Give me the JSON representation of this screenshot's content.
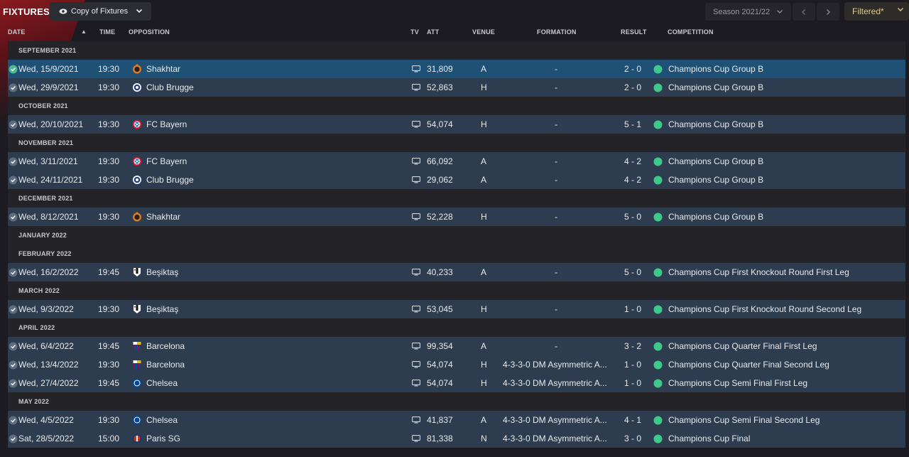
{
  "title": "FIXTURES",
  "view_select": {
    "label": "Copy of Fixtures",
    "icon": "eye-icon"
  },
  "season": {
    "label": "Season 2021/22"
  },
  "filter_button": {
    "label": "Filtered*"
  },
  "columns": {
    "date": "DATE",
    "time": "TIME",
    "opposition": "OPPOSITION",
    "tv": "TV",
    "att": "ATT",
    "venue": "VENUE",
    "formation": "FORMATION",
    "result": "RESULT",
    "competition": "COMPETITION"
  },
  "colors": {
    "win": "#3ec98a",
    "selected_row": "#1f5075",
    "row": "#2d3d4f",
    "accent_filter": "#e4c98c"
  },
  "months": [
    {
      "label": "SEPTEMBER 2021",
      "fixtures": [
        {
          "date": "Wed, 15/9/2021",
          "time": "19:30",
          "opponent": "Shakhtar",
          "crest": "shakhtar",
          "att": "31,809",
          "venue": "A",
          "formation": "-",
          "result": "2 - 0",
          "competition": "Champions Cup Group B",
          "selected": true
        },
        {
          "date": "Wed, 29/9/2021",
          "time": "19:30",
          "opponent": "Club Brugge",
          "crest": "brugge",
          "att": "52,863",
          "venue": "H",
          "formation": "-",
          "result": "2 - 0",
          "competition": "Champions Cup Group B"
        }
      ]
    },
    {
      "label": "OCTOBER 2021",
      "fixtures": [
        {
          "date": "Wed, 20/10/2021",
          "time": "19:30",
          "opponent": "FC Bayern",
          "crest": "bayern",
          "att": "54,074",
          "venue": "H",
          "formation": "-",
          "result": "5 - 1",
          "competition": "Champions Cup Group B"
        }
      ]
    },
    {
      "label": "NOVEMBER 2021",
      "fixtures": [
        {
          "date": "Wed, 3/11/2021",
          "time": "19:30",
          "opponent": "FC Bayern",
          "crest": "bayern",
          "att": "66,092",
          "venue": "A",
          "formation": "-",
          "result": "4 - 2",
          "competition": "Champions Cup Group B"
        },
        {
          "date": "Wed, 24/11/2021",
          "time": "19:30",
          "opponent": "Club Brugge",
          "crest": "brugge",
          "att": "29,062",
          "venue": "A",
          "formation": "-",
          "result": "4 - 2",
          "competition": "Champions Cup Group B"
        }
      ]
    },
    {
      "label": "DECEMBER 2021",
      "fixtures": [
        {
          "date": "Wed, 8/12/2021",
          "time": "19:30",
          "opponent": "Shakhtar",
          "crest": "shakhtar",
          "att": "52,228",
          "venue": "H",
          "formation": "-",
          "result": "5 - 0",
          "competition": "Champions Cup Group B"
        }
      ]
    },
    {
      "label": "JANUARY 2022",
      "fixtures": []
    },
    {
      "label": "FEBRUARY 2022",
      "fixtures": [
        {
          "date": "Wed, 16/2/2022",
          "time": "19:45",
          "opponent": "Beşiktaş",
          "crest": "besiktas",
          "att": "40,233",
          "venue": "A",
          "formation": "-",
          "result": "5 - 0",
          "competition": "Champions Cup First Knockout Round First Leg"
        }
      ]
    },
    {
      "label": "MARCH 2022",
      "fixtures": [
        {
          "date": "Wed, 9/3/2022",
          "time": "19:30",
          "opponent": "Beşiktaş",
          "crest": "besiktas",
          "att": "53,045",
          "venue": "H",
          "formation": "-",
          "result": "1 - 0",
          "competition": "Champions Cup First Knockout Round Second Leg"
        }
      ]
    },
    {
      "label": "APRIL 2022",
      "fixtures": [
        {
          "date": "Wed, 6/4/2022",
          "time": "19:45",
          "opponent": "Barcelona",
          "crest": "barcelona",
          "att": "99,354",
          "venue": "A",
          "formation": "-",
          "result": "3 - 2",
          "competition": "Champions Cup Quarter Final First Leg"
        },
        {
          "date": "Wed, 13/4/2022",
          "time": "19:30",
          "opponent": "Barcelona",
          "crest": "barcelona",
          "att": "54,074",
          "venue": "H",
          "formation": "4-3-3-0 DM Asymmetric A...",
          "result": "1 - 0",
          "competition": "Champions Cup Quarter Final Second Leg"
        },
        {
          "date": "Wed, 27/4/2022",
          "time": "19:45",
          "opponent": "Chelsea",
          "crest": "chelsea",
          "att": "54,074",
          "venue": "H",
          "formation": "4-3-3-0 DM Asymmetric A...",
          "result": "1 - 0",
          "competition": "Champions Cup Semi Final First Leg"
        }
      ]
    },
    {
      "label": "MAY 2022",
      "fixtures": [
        {
          "date": "Wed, 4/5/2022",
          "time": "19:30",
          "opponent": "Chelsea",
          "crest": "chelsea",
          "att": "41,837",
          "venue": "A",
          "formation": "4-3-3-0 DM Asymmetric A...",
          "result": "4 - 1",
          "competition": "Champions Cup Semi Final Second Leg"
        },
        {
          "date": "Sat, 28/5/2022",
          "time": "15:00",
          "opponent": "Paris SG",
          "crest": "psg",
          "att": "81,338",
          "venue": "N",
          "formation": "4-3-3-0 DM Asymmetric A...",
          "result": "3 - 0",
          "competition": "Champions Cup Final"
        }
      ]
    }
  ]
}
